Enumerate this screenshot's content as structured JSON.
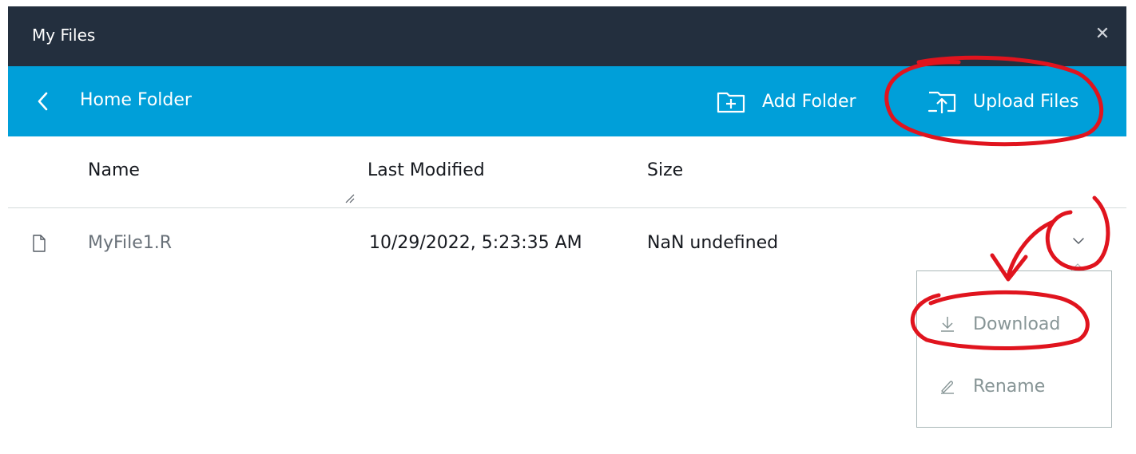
{
  "window": {
    "title": "My Files"
  },
  "toolbar": {
    "folder": "Home Folder",
    "add_folder_label": "Add Folder",
    "upload_files_label": "Upload Files"
  },
  "table": {
    "columns": [
      "Name",
      "Last Modified",
      "Size"
    ],
    "rows": [
      {
        "name": "MyFile1.R",
        "last_modified": "10/29/2022, 5:23:35 AM",
        "size": "NaN undefined"
      }
    ]
  },
  "row_menu": {
    "items": [
      {
        "label": "Download",
        "icon": "download-icon"
      },
      {
        "label": "Rename",
        "icon": "pencil-icon"
      }
    ]
  },
  "colors": {
    "titlebar": "#232f3e",
    "toolbar": "#009fd9",
    "annotation": "#e0141e"
  }
}
